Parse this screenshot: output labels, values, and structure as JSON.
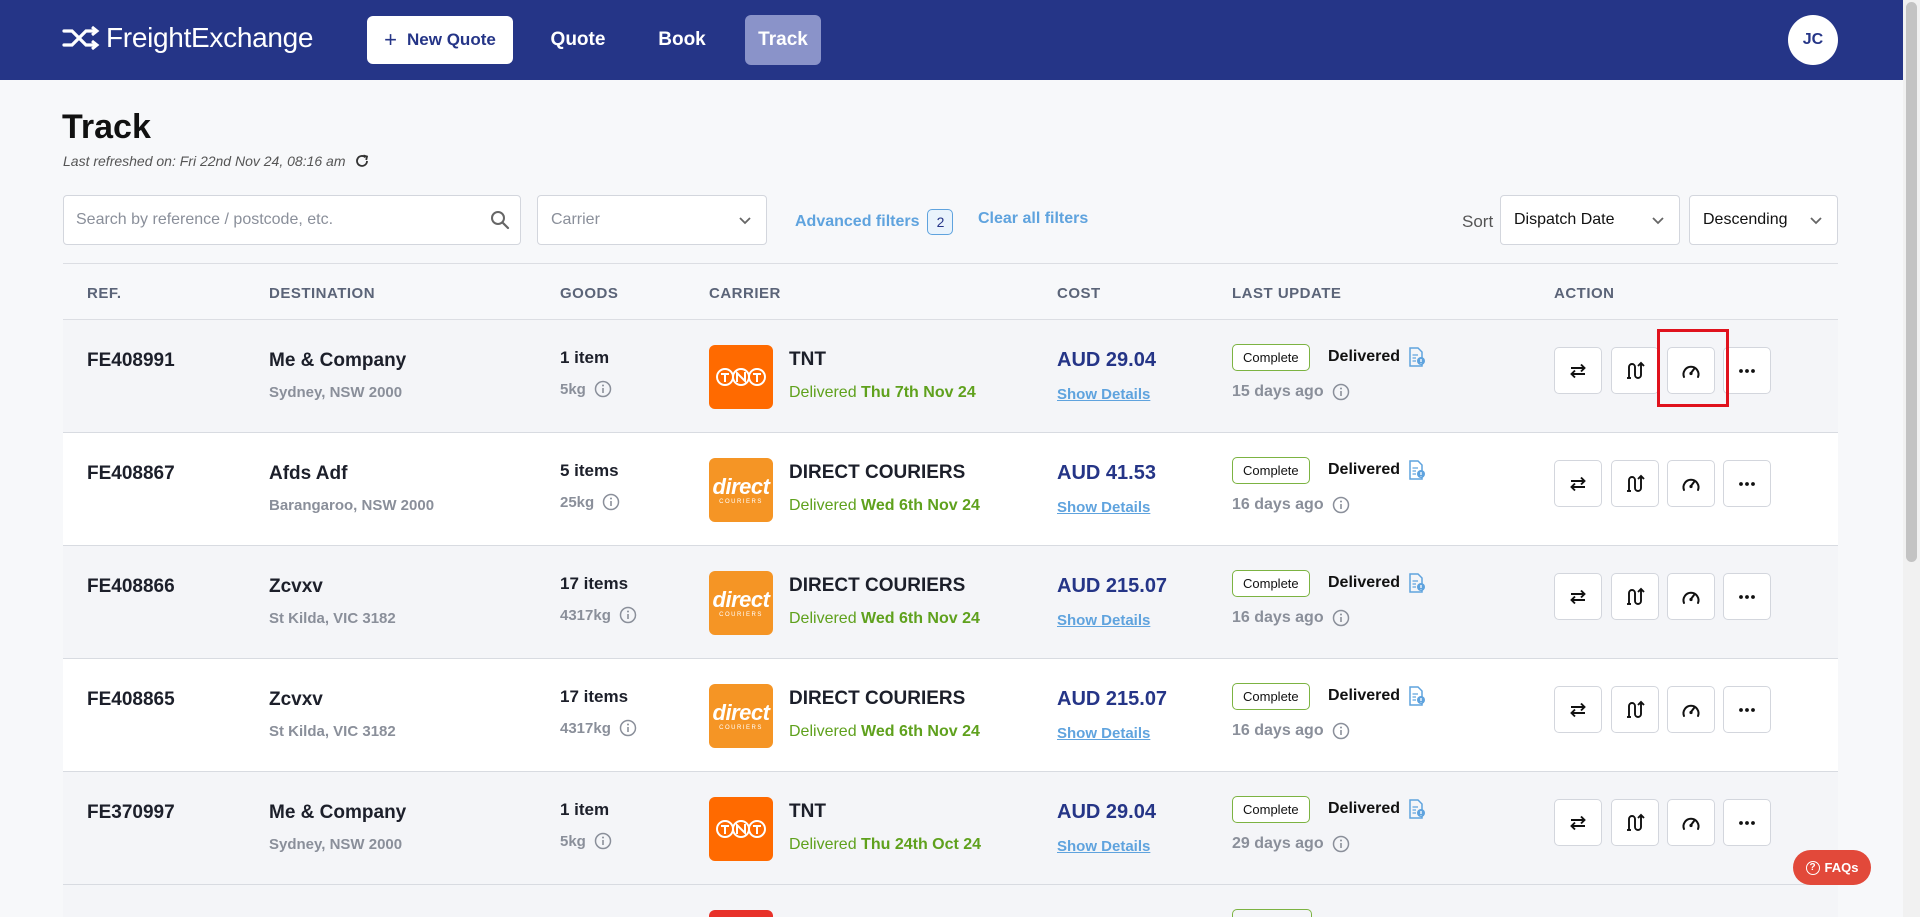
{
  "header": {
    "logo_text": "FreightExchange",
    "new_quote_label": "New Quote",
    "nav": {
      "quote": "Quote",
      "book": "Book",
      "track": "Track"
    },
    "avatar_initials": "JC",
    "brand_color": "#253587"
  },
  "page": {
    "title": "Track",
    "last_refreshed": "Last refreshed on: Fri 22nd Nov 24, 08:16 am"
  },
  "filters": {
    "search_placeholder": "Search by reference / postcode, etc.",
    "carrier_placeholder": "Carrier",
    "advanced_filters_label": "Advanced filters",
    "advanced_filters_count": "2",
    "clear_all_label": "Clear all filters",
    "sort_label": "Sort",
    "sort_by": "Dispatch Date",
    "sort_order": "Descending"
  },
  "table": {
    "headers": {
      "ref": "REF.",
      "destination": "DESTINATION",
      "goods": "GOODS",
      "carrier": "CARRIER",
      "cost": "COST",
      "last_update": "LAST UPDATE",
      "action": "ACTION"
    },
    "rows": [
      {
        "ref": "FE408991",
        "dest_name": "Me & Company",
        "dest_loc": "Sydney, NSW 2000",
        "items": "1 item",
        "weight": "5kg",
        "carrier_logo": "tnt",
        "carrier": "TNT",
        "status_prefix": "Delivered",
        "status_date": "Thu 7th Nov 24",
        "cost": "AUD 29.04",
        "show_details": "Show Details",
        "badge": "Complete",
        "delivered": "Delivered",
        "ago": "15 days ago"
      },
      {
        "ref": "FE408867",
        "dest_name": "Afds Adf",
        "dest_loc": "Barangaroo, NSW 2000",
        "items": "5 items",
        "weight": "25kg",
        "carrier_logo": "direct",
        "carrier": "DIRECT COURIERS",
        "status_prefix": "Delivered",
        "status_date": "Wed 6th Nov 24",
        "cost": "AUD 41.53",
        "show_details": "Show Details",
        "badge": "Complete",
        "delivered": "Delivered",
        "ago": "16 days ago"
      },
      {
        "ref": "FE408866",
        "dest_name": "Zcvxv",
        "dest_loc": "St Kilda, VIC 3182",
        "items": "17 items",
        "weight": "4317kg",
        "carrier_logo": "direct",
        "carrier": "DIRECT COURIERS",
        "status_prefix": "Delivered",
        "status_date": "Wed 6th Nov 24",
        "cost": "AUD 215.07",
        "show_details": "Show Details",
        "badge": "Complete",
        "delivered": "Delivered",
        "ago": "16 days ago"
      },
      {
        "ref": "FE408865",
        "dest_name": "Zcvxv",
        "dest_loc": "St Kilda, VIC 3182",
        "items": "17 items",
        "weight": "4317kg",
        "carrier_logo": "direct",
        "carrier": "DIRECT COURIERS",
        "status_prefix": "Delivered",
        "status_date": "Wed 6th Nov 24",
        "cost": "AUD 215.07",
        "show_details": "Show Details",
        "badge": "Complete",
        "delivered": "Delivered",
        "ago": "16 days ago"
      },
      {
        "ref": "FE370997",
        "dest_name": "Me & Company",
        "dest_loc": "Sydney, NSW 2000",
        "items": "1 item",
        "weight": "5kg",
        "carrier_logo": "tnt",
        "carrier": "TNT",
        "status_prefix": "Delivered",
        "status_date": "Thu 24th Oct 24",
        "cost": "AUD 29.04",
        "show_details": "Show Details",
        "badge": "Complete",
        "delivered": "Delivered",
        "ago": "29 days ago"
      }
    ],
    "action_icons": [
      "swap-arrows-icon",
      "route-icon",
      "gauge-icon",
      "more-icon"
    ]
  },
  "faq_label": "FAQs",
  "colors": {
    "accent_link": "#5fa3de",
    "status_green": "#5fa11d",
    "highlight_red": "#e0121d",
    "faq_red": "#e2493a"
  }
}
